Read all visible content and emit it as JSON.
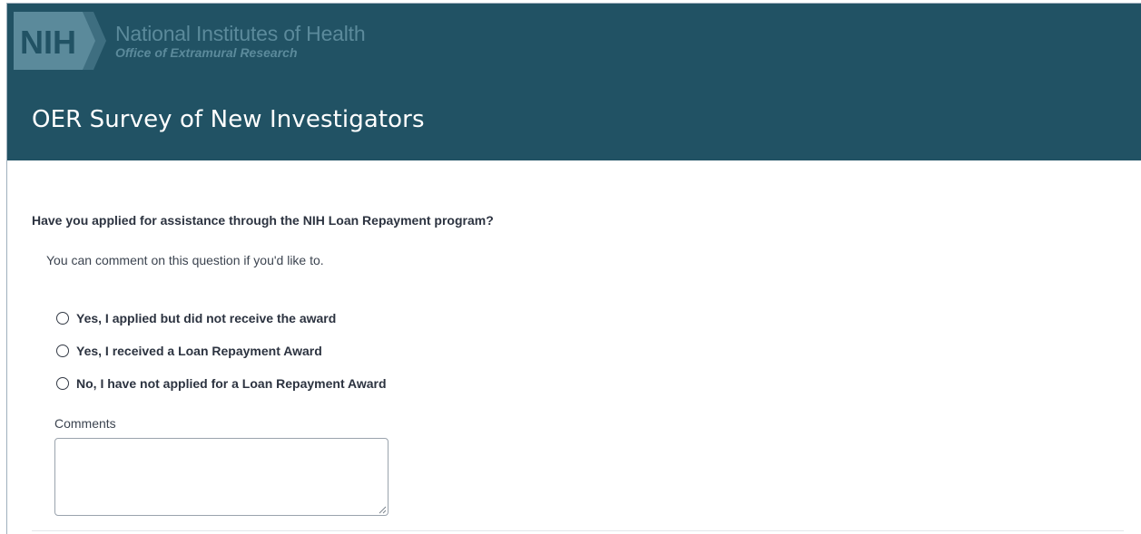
{
  "header": {
    "logo": {
      "badge_text": "NIH",
      "org_name": "National Institutes of Health",
      "office_name": "Office of Extramural Research"
    },
    "survey_title": "OER Survey of New Investigators",
    "colors": {
      "header_bg": "#215264",
      "logo_text": "#5b8a9b"
    }
  },
  "question": {
    "text": "Have you applied for assistance through the NIH Loan Repayment program?",
    "help_text": "You can comment on this question if you'd like to.",
    "options": [
      {
        "label": "Yes, I applied but did not receive the award",
        "selected": false
      },
      {
        "label": "Yes, I received a Loan Repayment Award",
        "selected": false
      },
      {
        "label": "No, I have not applied for a Loan Repayment Award",
        "selected": false
      }
    ],
    "comments": {
      "label": "Comments",
      "value": ""
    }
  }
}
